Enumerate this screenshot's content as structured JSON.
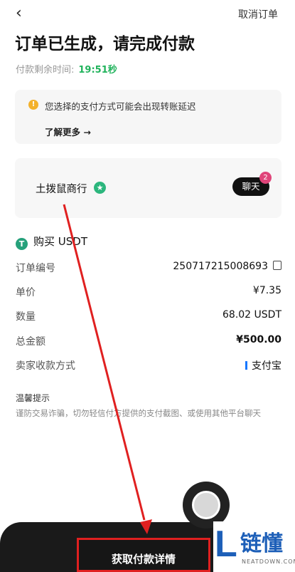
{
  "header": {
    "cancel_label": "取消订单"
  },
  "title": "订单已生成，请完成付款",
  "timer": {
    "label": "付款剩余时间:",
    "value": "19:51秒"
  },
  "notice": {
    "text": "您选择的支付方式可能会出现转账延迟",
    "learn_more": "了解更多 →"
  },
  "merchant": {
    "name": "土拨鼠商行",
    "chat_label": "聊天",
    "chat_count": "2"
  },
  "order": {
    "heading": "购买 USDT",
    "rows": [
      {
        "label": "订单编号",
        "value": "250717215008693"
      },
      {
        "label": "单价",
        "value": "¥7.35"
      },
      {
        "label": "数量",
        "value": "68.02 USDT"
      },
      {
        "label": "总金额",
        "value": "¥500.00"
      },
      {
        "label": "卖家收款方式",
        "value": "支付宝"
      }
    ]
  },
  "tips": {
    "title": "温馨提示",
    "text": "谨防交易诈骗，切勿轻信付方提供的支付截图、或使用其他平台聊天"
  },
  "cta_label": "获取付款详情",
  "watermark": {
    "brand": "链懂",
    "sub": "NEATDOWN.COM"
  },
  "colors": {
    "accent_green": "#21b35c",
    "annotation_red": "#e02020",
    "brand_blue": "#1d5fb8"
  }
}
